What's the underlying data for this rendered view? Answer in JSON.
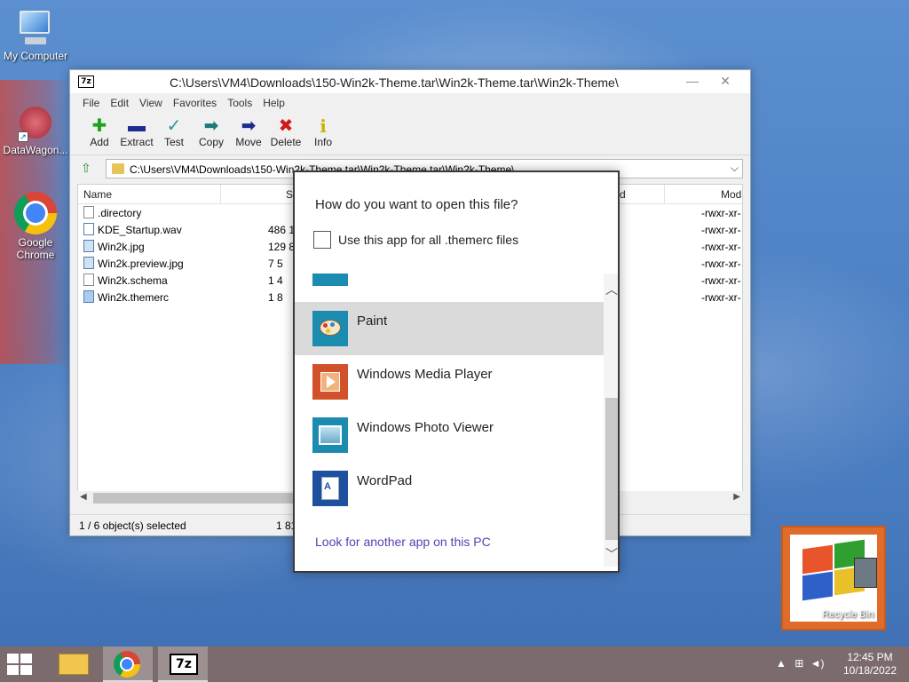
{
  "desktop": {
    "icons": [
      {
        "label": "My Computer"
      },
      {
        "label": "DataWagon..."
      },
      {
        "label": "Google Chrome"
      }
    ],
    "recycle_bin": {
      "label": "Recycle Bin"
    }
  },
  "window": {
    "app_icon": "7z",
    "title": "C:\\Users\\VM4\\Downloads\\150-Win2k-Theme.tar\\Win2k-Theme.tar\\Win2k-Theme\\",
    "menu": [
      "File",
      "Edit",
      "View",
      "Favorites",
      "Tools",
      "Help"
    ],
    "toolbar": [
      {
        "label": "Add",
        "icon": "add-icon",
        "color": "#1aa51a"
      },
      {
        "label": "Extract",
        "icon": "extract-icon",
        "color": "#1f2a8f"
      },
      {
        "label": "Test",
        "icon": "test-icon",
        "color": "#2a9a9a"
      },
      {
        "label": "Copy",
        "icon": "copy-icon",
        "color": "#1a7a7a"
      },
      {
        "label": "Move",
        "icon": "move-icon",
        "color": "#1f2a8f"
      },
      {
        "label": "Delete",
        "icon": "delete-icon",
        "color": "#d01a1a"
      },
      {
        "label": "Info",
        "icon": "info-icon",
        "color": "#c8b400"
      }
    ],
    "address": "C:\\Users\\VM4\\Downloads\\150-Win2k-Theme.tar\\Win2k-Theme.tar\\Win2k-Theme\\",
    "columns": {
      "name": "Name",
      "size": "Si",
      "col3": "d",
      "mode": "Mod"
    },
    "files": [
      {
        "name": ".directory",
        "size": "",
        "mode": "-rwxr-xr-"
      },
      {
        "name": "KDE_Startup.wav",
        "size": "486 1",
        "mode": "-rwxr-xr-"
      },
      {
        "name": "Win2k.jpg",
        "size": "129 8",
        "mode": "-rwxr-xr-"
      },
      {
        "name": "Win2k.preview.jpg",
        "size": "7 5",
        "mode": "-rwxr-xr-"
      },
      {
        "name": "Win2k.schema",
        "size": "1 4",
        "mode": "-rwxr-xr-"
      },
      {
        "name": "Win2k.themerc",
        "size": "1 8",
        "mode": "-rwxr-xr-"
      }
    ],
    "status": {
      "selection": "1 / 6 object(s) selected",
      "size": "1 81"
    }
  },
  "dialog": {
    "question": "How do you want to open this file?",
    "checkbox_label": "Use this app for all .themerc files",
    "checkbox_checked": false,
    "apps": [
      {
        "name": "",
        "icon": "unknown-app-icon",
        "color": "#1b8bb0"
      },
      {
        "name": "Paint",
        "icon": "paint-icon",
        "color": "#1b8bb0"
      },
      {
        "name": "Windows Media Player",
        "icon": "media-player-icon",
        "color": "#d2502a"
      },
      {
        "name": "Windows Photo Viewer",
        "icon": "photo-viewer-icon",
        "color": "#1b8bb0"
      },
      {
        "name": "WordPad",
        "icon": "wordpad-icon",
        "color": "#1f4f9f"
      }
    ],
    "selected_app": "Paint",
    "link": "Look for another app on this PC"
  },
  "taskbar": {
    "clock_time": "12:45 PM",
    "clock_date": "10/18/2022"
  }
}
